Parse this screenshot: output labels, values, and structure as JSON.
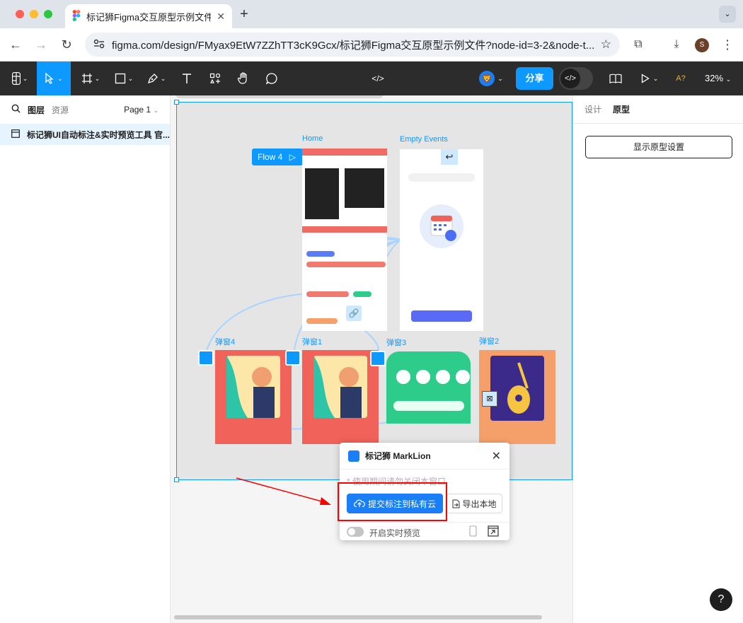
{
  "browser": {
    "tab_title": "标记狮Figma交互原型示例文件",
    "url": "figma.com/design/FMyax9EtW7ZZhTT3cK9Gcx/标记狮Figma交互原型示例文件?node-id=3-2&node-t...",
    "profile_initial": "S"
  },
  "figma_toolbar": {
    "share_label": "分享",
    "zoom": "32%",
    "a11y_label": "A?"
  },
  "left_panel": {
    "tabs": [
      "图层",
      "资源"
    ],
    "page_selector": "Page 1",
    "layer_name": "标记狮UI自动标注&实时预览工具 官..."
  },
  "right_panel": {
    "tabs": [
      "设计",
      "原型"
    ],
    "prototype_settings_button": "显示原型设置"
  },
  "canvas": {
    "flow_label": "Flow 4",
    "frames": {
      "home": "Home",
      "empty_events": "Empty Events",
      "popup1": "弹窗1",
      "popup2": "弹窗2",
      "popup3": "弹窗3",
      "popup4": "弹窗4"
    }
  },
  "plugin": {
    "title": "标记狮 MarkLion",
    "hint": "* 使用期间请勿关闭本窗口",
    "submit_button": "提交标注到私有云",
    "export_button": "导出本地",
    "realtime_toggle_label": "开启实时预览",
    "realtime_enabled": false
  },
  "colors": {
    "accent": "#0d99ff",
    "submit": "#1a7ef7",
    "annotation": "#ff0000",
    "popup_red": "#f0625a",
    "popup_green": "#2ecc8b",
    "popup_orange": "#f5a06b"
  }
}
